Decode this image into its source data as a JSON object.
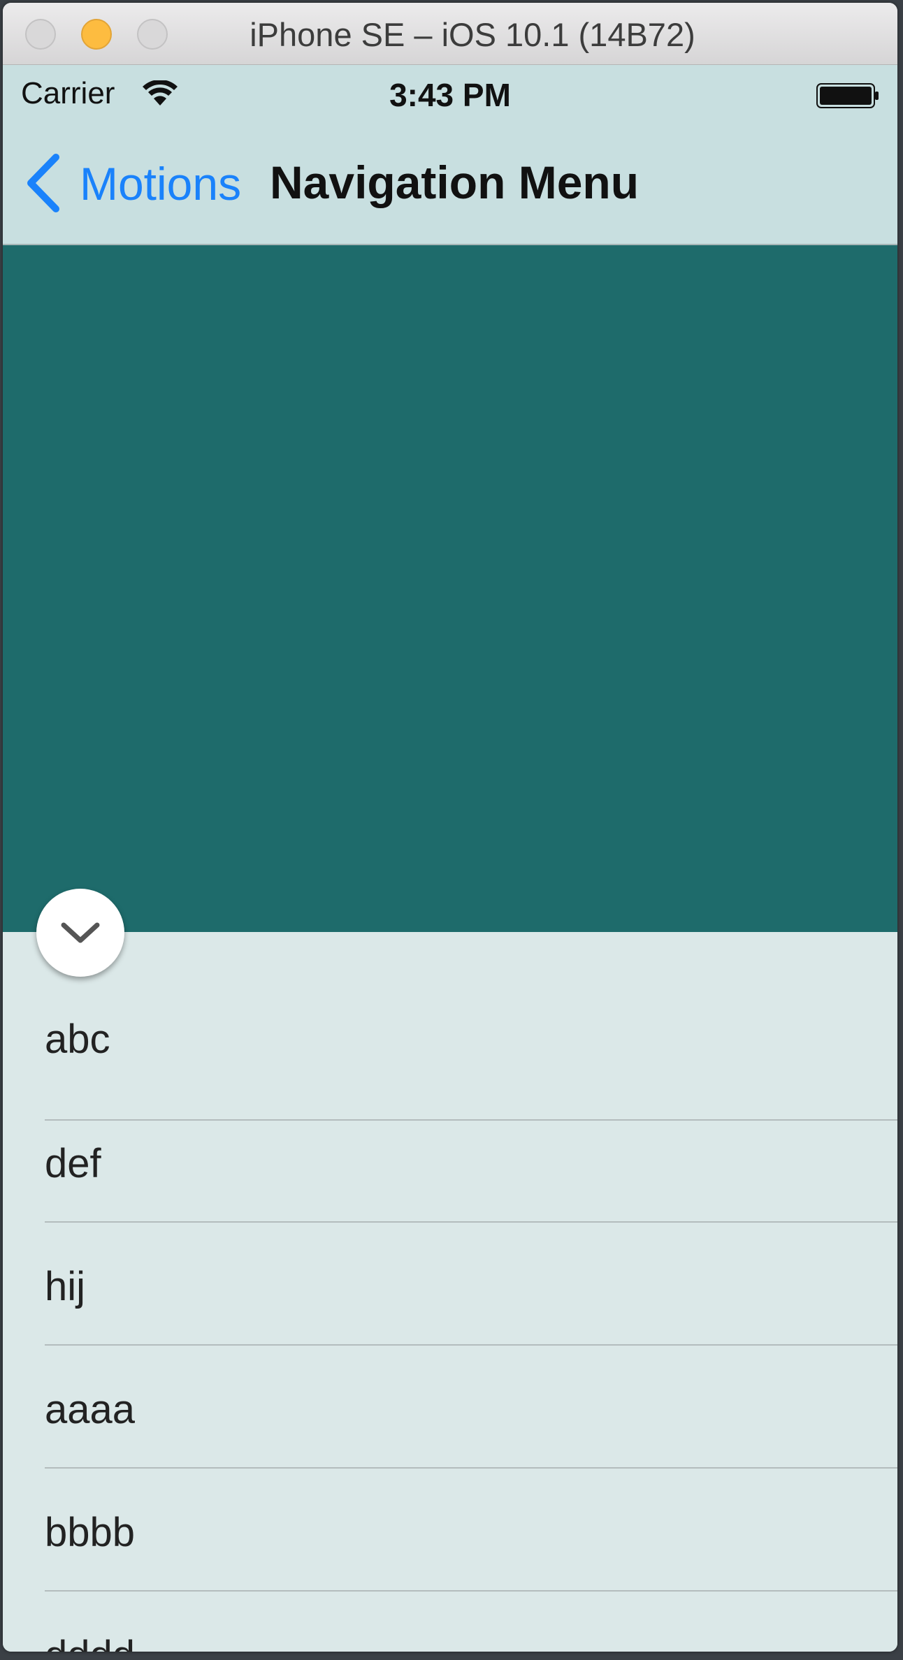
{
  "window": {
    "title": "iPhone SE – iOS 10.1 (14B72)"
  },
  "status_bar": {
    "carrier": "Carrier",
    "time": "3:43 PM"
  },
  "nav_bar": {
    "back_label": "Motions",
    "title": "Navigation Menu"
  },
  "colors": {
    "hero": "#1e6b6b",
    "accent": "#1a82fb",
    "background": "#dbe8e8"
  },
  "icons": {
    "back": "chevron-left-icon",
    "toggle": "chevron-down-icon",
    "wifi": "wifi-icon",
    "battery": "battery-icon"
  },
  "menu": {
    "items": [
      {
        "label": "abc"
      },
      {
        "label": "def"
      },
      {
        "label": "hij"
      },
      {
        "label": "aaaa"
      },
      {
        "label": "bbbb"
      },
      {
        "label": "dddd"
      }
    ]
  }
}
